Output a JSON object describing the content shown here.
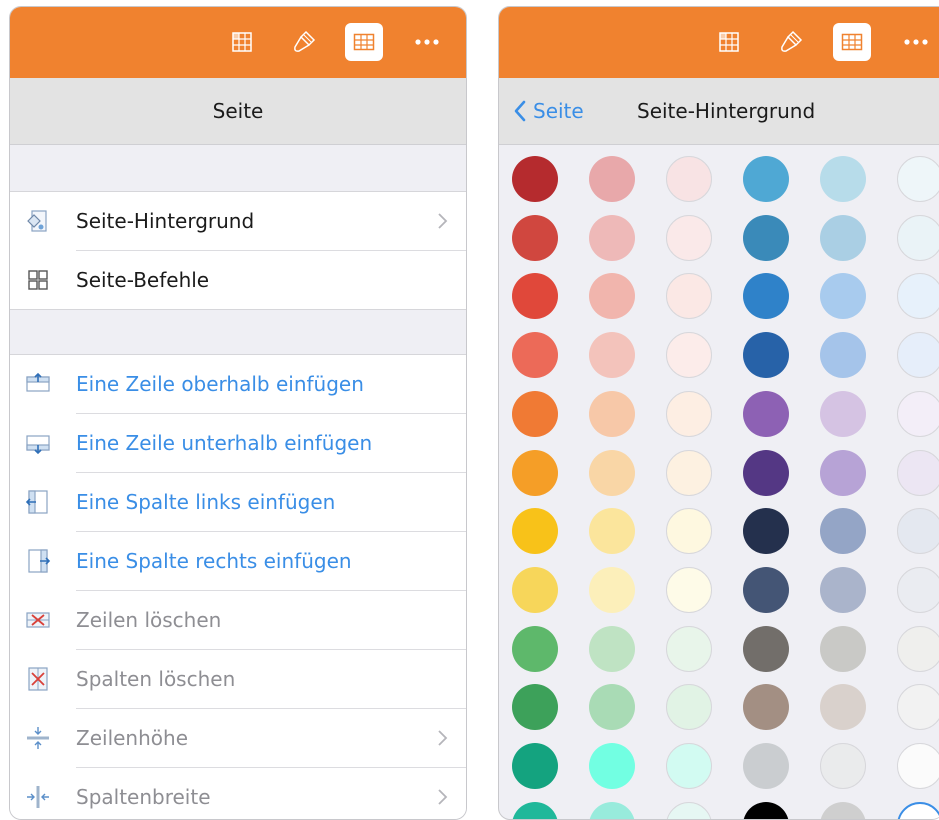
{
  "left_panel": {
    "toolbar_icons": [
      "table-icon",
      "paintbrush-icon",
      "grid-icon",
      "more-icon"
    ],
    "title": "Seite",
    "menu": [
      {
        "label": "Seite-Hintergrund",
        "icon": "page-background-icon",
        "chevron": true
      },
      {
        "label": "Seite-Befehle",
        "icon": "page-commands-icon",
        "chevron": false
      }
    ],
    "actions": [
      {
        "label": "Eine Zeile oberhalb einfügen",
        "icon": "insert-row-above-icon",
        "style": "blue",
        "chevron": false
      },
      {
        "label": "Eine Zeile unterhalb einfügen",
        "icon": "insert-row-below-icon",
        "style": "blue",
        "chevron": false
      },
      {
        "label": "Eine Spalte links einfügen",
        "icon": "insert-column-left-icon",
        "style": "blue",
        "chevron": false
      },
      {
        "label": "Eine Spalte rechts einfügen",
        "icon": "insert-column-right-icon",
        "style": "blue",
        "chevron": false
      },
      {
        "label": "Zeilen löschen",
        "icon": "delete-rows-icon",
        "style": "gray",
        "chevron": false
      },
      {
        "label": "Spalten löschen",
        "icon": "delete-columns-icon",
        "style": "gray",
        "chevron": false
      },
      {
        "label": "Zeilenhöhe",
        "icon": "row-height-icon",
        "style": "gray",
        "chevron": true
      },
      {
        "label": "Spaltenbreite",
        "icon": "column-width-icon",
        "style": "gray",
        "chevron": true
      }
    ]
  },
  "right_panel": {
    "back_label": "Seite",
    "title": "Seite-Hintergrund",
    "selected_color": "#ffffff",
    "color_rows": [
      [
        "#b52b2e",
        "#e8a8aa",
        "#f8e3e4",
        "#4fa8d4",
        "#b7dcea",
        "#eef6f9"
      ],
      [
        "#d0473f",
        "#eeb9b8",
        "#fae9e9",
        "#3a8ab9",
        "#aacfe4",
        "#eaf3f7"
      ],
      [
        "#e0483a",
        "#f1b5ad",
        "#fbe8e5",
        "#2f82c9",
        "#a8cbee",
        "#e7f1fb"
      ],
      [
        "#ec6a58",
        "#f3c3bb",
        "#fcecea",
        "#2762a8",
        "#a5c4ea",
        "#e6eefa"
      ],
      [
        "#f07a34",
        "#f7c8a8",
        "#fdeee3",
        "#8d61b4",
        "#d5c3e3",
        "#f3eef8"
      ],
      [
        "#f59e27",
        "#f9d6a6",
        "#fdf1e1",
        "#543784",
        "#b7a3d6",
        "#ece6f3"
      ],
      [
        "#f8c219",
        "#fbe59c",
        "#fef8e0",
        "#24304d",
        "#94a5c6",
        "#e4e8f0"
      ],
      [
        "#f7d65a",
        "#fcefba",
        "#fefbe8",
        "#445575",
        "#aab4cb",
        "#eaecf1"
      ],
      [
        "#5eb86b",
        "#bfe3c3",
        "#e8f5ea",
        "#726e6a",
        "#c9c9c6",
        "#efefed"
      ],
      [
        "#3da15a",
        "#a9dbb5",
        "#e1f3e5",
        "#a38f83",
        "#d9d1cc",
        "#f2f2f2"
      ],
      [
        "#14a37f",
        "#72ffe2",
        "#d2fbf2",
        "#cacdd0",
        "#eaebec",
        "#fbfbfb"
      ],
      [
        "#1fb89a",
        "#98ebdc",
        "#e6f7f3",
        "#000000",
        "#cfcfcf",
        "#ffffff"
      ]
    ]
  }
}
